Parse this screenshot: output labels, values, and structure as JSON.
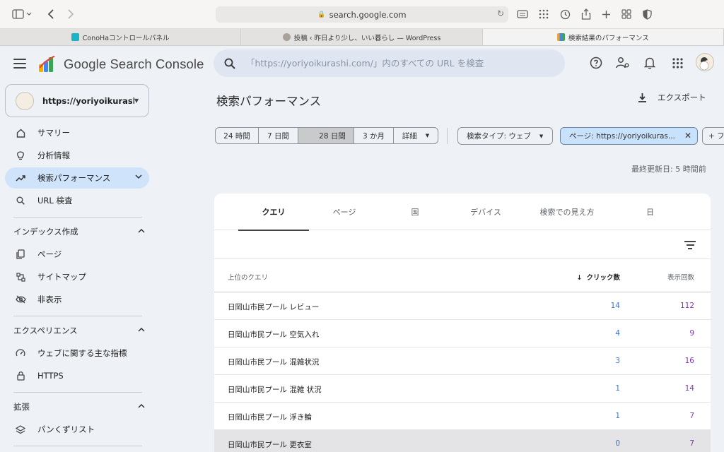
{
  "browser": {
    "address": "search.google.com",
    "tabs": [
      {
        "label": "ConoHaコントロールパネル",
        "color": "#19b5c7"
      },
      {
        "label": "投稿 ‹ 昨日より少し、いい暮らし — WordPress",
        "color": "#a9a29a"
      },
      {
        "label": "検索結果のパフォーマンス",
        "color": "#e8a33a"
      }
    ]
  },
  "header": {
    "app_name": "Google Search Console",
    "search_placeholder": "「https://yoriyoikurashi.com/」内のすべての URL を検査"
  },
  "sidebar": {
    "property": "https://yoriyoikurashi....",
    "items": [
      {
        "label": "サマリー",
        "icon": "home-icon"
      },
      {
        "label": "分析情報",
        "icon": "lightbulb-icon"
      },
      {
        "label": "検索パフォーマンス",
        "icon": "trending-up-icon"
      },
      {
        "label": "URL 検査",
        "icon": "search-icon"
      }
    ],
    "section_index": "インデックス作成",
    "index_items": [
      {
        "label": "ページ",
        "icon": "pages-icon"
      },
      {
        "label": "サイトマップ",
        "icon": "sitemap-icon"
      },
      {
        "label": "非表示",
        "icon": "eye-off-icon"
      }
    ],
    "section_experience": "エクスペリエンス",
    "experience_items": [
      {
        "label": "ウェブに関する主な指標",
        "icon": "speedometer-icon"
      },
      {
        "label": "HTTPS",
        "icon": "lock-icon"
      }
    ],
    "section_enhancements": "拡張",
    "enhancement_items": [
      {
        "label": "パンくずリスト",
        "icon": "layers-icon"
      }
    ]
  },
  "main": {
    "title": "検索パフォーマンス",
    "export_label": "エクスポート",
    "date_ranges": [
      "24 時間",
      "7 日間",
      "28 日間",
      "3 か月",
      "詳細"
    ],
    "date_selected": "28 日間",
    "search_type_chip": "検索タイプ: ウェブ",
    "page_filter_chip": "ページ: https://yoriyoikuras...",
    "add_filter_chip": "+ フ",
    "last_updated": "最終更新日: 5 時間前",
    "tabs": [
      "クエリ",
      "ページ",
      "国",
      "デバイス",
      "検索での見え方",
      "日"
    ],
    "active_tab": "クエリ",
    "table": {
      "headers": {
        "query": "上位のクエリ",
        "clicks": "クリック数",
        "impressions": "表示回数"
      },
      "rows": [
        {
          "query": "日岡山市民プール レビュー",
          "clicks": "14",
          "impressions": "112"
        },
        {
          "query": "日岡山市民プール 空気入れ",
          "clicks": "4",
          "impressions": "9"
        },
        {
          "query": "日岡山市民プール 混雑状況",
          "clicks": "3",
          "impressions": "16"
        },
        {
          "query": "日岡山市民プール 混雑 状況",
          "clicks": "1",
          "impressions": "14"
        },
        {
          "query": "日岡山市民プール 浮き輪",
          "clicks": "1",
          "impressions": "7"
        },
        {
          "query": "日岡山市民プール 更衣室",
          "clicks": "0",
          "impressions": "7"
        }
      ]
    }
  }
}
